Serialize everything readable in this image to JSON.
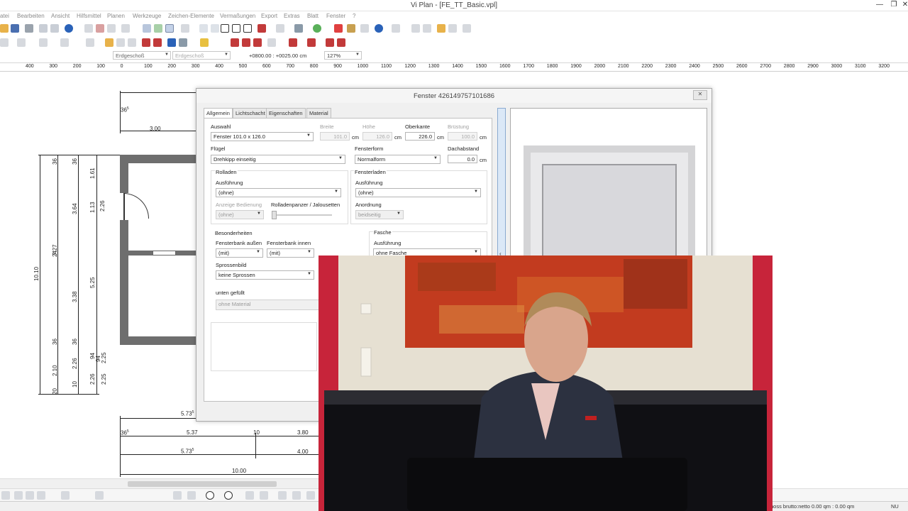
{
  "window": {
    "title": "Vi Plan - [FE_TT_Basic.vpl]",
    "min_glyph": "—",
    "restore_glyph": "❐",
    "close_glyph": "✕"
  },
  "menu": [
    "atei",
    "Bearbeiten",
    "Ansicht",
    "Hilfsmittel",
    "Planen",
    "Werkzeuge",
    "Zeichen-Elemente",
    "Vermaßungen",
    "Export",
    "Extras",
    "Blatt",
    "Fenster",
    "?"
  ],
  "toolbar": {
    "floor_select": "Erdgeschoß",
    "floor_select_2": "Erdgeschoß",
    "coordinates": "+0800.00 : +0025.00 cm",
    "zoom": "127%"
  },
  "ruler": {
    "ticks": [
      "400",
      "300",
      "200",
      "100",
      "0",
      "100",
      "200",
      "300",
      "400",
      "500",
      "600",
      "700",
      "800",
      "900",
      "1000",
      "1100",
      "1200",
      "1300",
      "1400",
      "1500",
      "1600",
      "1700",
      "1800",
      "1900",
      "2000",
      "2100",
      "2200",
      "2300",
      "2400",
      "2500",
      "2600",
      "2700",
      "2800",
      "2900",
      "3000",
      "3100",
      "3200"
    ]
  },
  "drawing": {
    "dim_top_a": "36",
    "dim_top_a_sup": "5",
    "dim_top_b": "3.00",
    "vertical_dims_left": [
      "10.10"
    ],
    "vertical_dims_mid": [
      "36",
      "7.27",
      "24",
      "2.10",
      "20",
      "36"
    ],
    "vertical_dims_right": [
      "36",
      "3.64",
      "3.38",
      "2.26",
      "10",
      "36"
    ],
    "vertical_dims_far": [
      "1.61",
      "1.13",
      "5.25",
      "94",
      "2.26",
      "94",
      "2.25",
      "2.25"
    ],
    "dim_2_26": "2.26",
    "bottom_dims": {
      "row1": "5.73",
      "row1_sup": "5",
      "row2_a": "36",
      "row2_a_sup": "5",
      "row2_b": "5.37",
      "row2_c": "10",
      "row2_d": "3.80",
      "row3_a": "5.73",
      "row3_a_sup": "5",
      "row3_b": "4.00",
      "row4": "10.00"
    }
  },
  "dialog": {
    "title": "Fenster 426149757101686",
    "close": "✕",
    "tabs": [
      "Allgemein",
      "Lichtschacht",
      "Eigenschaften",
      "Material"
    ],
    "auswahl_label": "Auswahl",
    "auswahl_value": "Fenster 101.0 x 126.0",
    "breite_label": "Breite",
    "breite_value": "101.0",
    "hoehe_label": "Höhe",
    "hoehe_value": "126.0",
    "oberkante_label": "Oberkante",
    "oberkante_value": "226.0",
    "bruestung_label": "Brüstung",
    "bruestung_value": "100.0",
    "unit": "cm",
    "fluegel_label": "Flügel",
    "fluegel_value": "Drehkipp einseitig",
    "fensterform_label": "Fensterform",
    "fensterform_value": "Normalform",
    "dachabstand_label": "Dachabstand",
    "dachabstand_value": "0.0",
    "rolladen_group": "Rolladen",
    "rolladen_ausfuehrung_label": "Ausführung",
    "rolladen_ausfuehrung_value": "(ohne)",
    "anzeige_label": "Anzeige Bedienung",
    "anzeige_value": "(ohne)",
    "rolladenpanzer_label": "Rolladenpanzer / Jalousetten",
    "fensterladen_group": "Fensterladen",
    "fensterladen_ausfuehrung_label": "Ausführung",
    "fensterladen_ausfuehrung_value": "(ohne)",
    "anordnung_label": "Anordnung",
    "anordnung_value": "beidseitig",
    "besonderheiten_group": "Besonderheiten",
    "fensterbank_aussen_label": "Fensterbank außen",
    "fensterbank_aussen_value": "(mit)",
    "fensterbank_innen_label": "Fensterbank innen",
    "fensterbank_innen_value": "(mit)",
    "sprossenbild_label": "Sprossenbild",
    "sprossenbild_value": "keine Sprossen",
    "fasche_group": "Fasche",
    "fasche_ausfuehrung_label": "Ausführung",
    "fasche_ausfuehrung_value": "ohne Fasche",
    "unten_gefuellt_label": "unten gefüllt",
    "unten_gefuellt_value": "ohne Material"
  },
  "status": {
    "text": "hoss brutto:netto 0.00 qm : 0.00 qm",
    "nu": "NU"
  },
  "colors": {
    "wall": "#6e6e6e",
    "video_wall": "#e7e1d4",
    "painting": "#c23b1f",
    "suit": "#2c3140"
  }
}
